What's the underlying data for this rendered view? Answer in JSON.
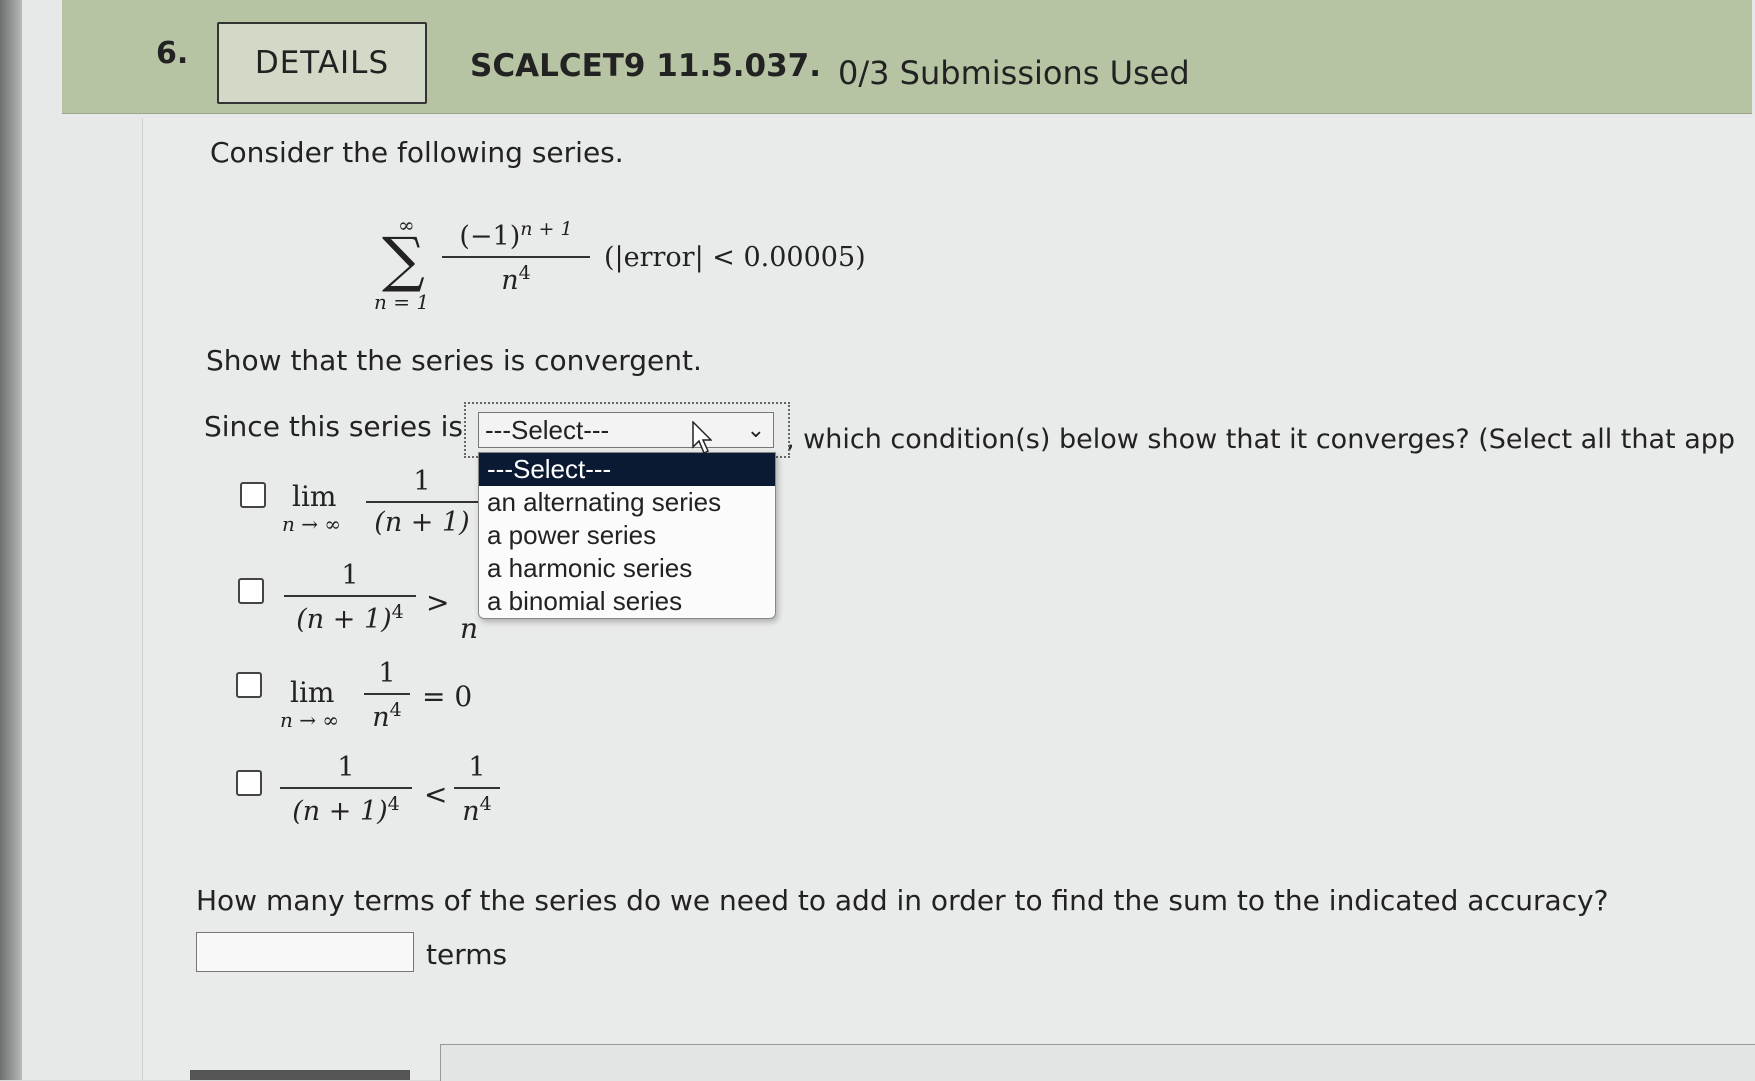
{
  "header": {
    "question_number": "6.",
    "details_label": "DETAILS",
    "question_id": "SCALCET9 11.5.037.",
    "submissions": "0/3 Submissions Used"
  },
  "problem": {
    "intro": "Consider the following series.",
    "series": {
      "sigma": "∑",
      "upper": "∞",
      "lower": "n = 1",
      "numerator": "(−1)",
      "numerator_exp": "n + 1",
      "denominator": "n",
      "denominator_exp": "4",
      "condition": "(|error| < 0.00005)"
    },
    "show_text": "Show that the series is convergent.",
    "since_prefix": "Since this series is",
    "since_suffix": ", which condition(s) below show that it converges? (Select all that app"
  },
  "dropdown": {
    "current": "---Select---",
    "options": [
      "---Select---",
      "an alternating series",
      "a power series",
      "a harmonic series",
      "a binomial series"
    ]
  },
  "conditions": [
    {
      "lim": "lim",
      "sub": "n → ∞",
      "num": "1",
      "den": "(n + 1)"
    },
    {
      "num": "1",
      "den": "(n + 1)",
      "den_exp": "4",
      "rel": ">",
      "rhs_den": "n"
    },
    {
      "lim": "lim",
      "sub": "n → ∞",
      "num": "1",
      "den": "n",
      "den_exp": "4",
      "eq": "= 0"
    },
    {
      "num": "1",
      "den": "(n + 1)",
      "den_exp": "4",
      "rel": "<",
      "rhs_num": "1",
      "rhs_den": "n",
      "rhs_exp": "4"
    }
  ],
  "terms_question": "How many terms of the series do we need to add in order to find the sum to the indicated accuracy?",
  "terms_input": {
    "value": "",
    "unit": "terms"
  }
}
